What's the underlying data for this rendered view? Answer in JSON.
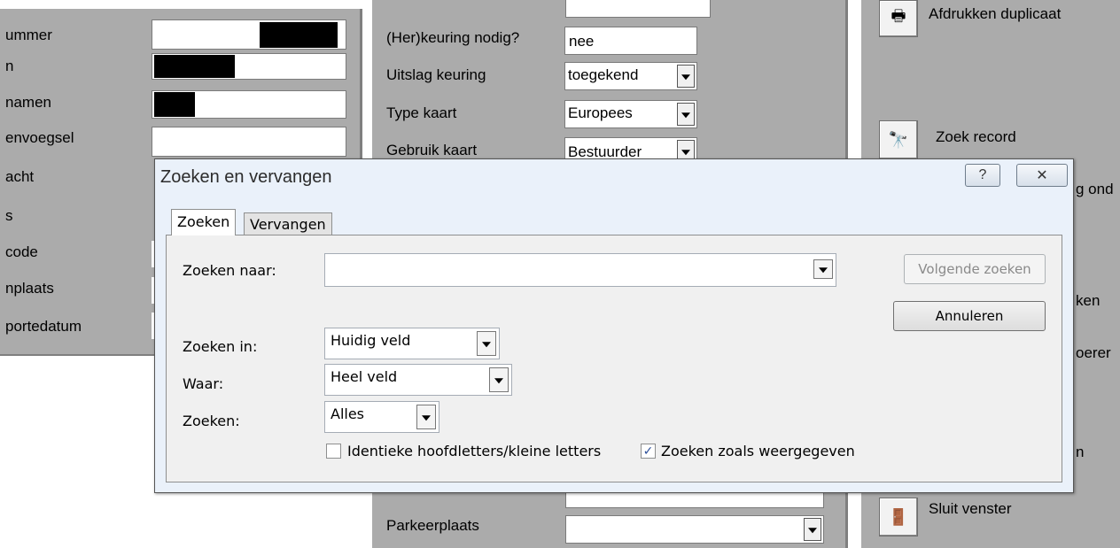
{
  "form_left": {
    "labels": [
      "ummer",
      "n",
      "namen",
      "envoegsel",
      "acht",
      "s",
      "code",
      "nplaats",
      "portedatum"
    ]
  },
  "form_mid": {
    "herkeuring_label": "(Her)keuring nodig?",
    "herkeuring_value": "nee",
    "uitslag_label": "Uitslag keuring",
    "uitslag_value": "toegekend",
    "type_label": "Type kaart",
    "type_value": "Europees",
    "gebruik_label": "Gebruik kaart",
    "gebruik_value": "Bestuurder",
    "parkeer_label": "Parkeerplaats",
    "parkeer_value": ""
  },
  "sidebar": {
    "afdrukken_label": "Afdrukken duplicaat",
    "zoek_label": "Zoek record",
    "partial1": "g ond",
    "partial2": "ken",
    "partial3": "oerer",
    "partial4": "n",
    "sluit_label": "Sluit venster",
    "icons": {
      "print": "🖶",
      "binoculars": "🔭",
      "exit": "🚪"
    }
  },
  "dialog": {
    "title": "Zoeken en vervangen",
    "help_glyph": "?",
    "close_glyph": "✕",
    "tabs": [
      "Zoeken",
      "Vervangen"
    ],
    "zoeken_naar_label": "Zoeken naar:",
    "zoeken_naar_value": "",
    "zoeken_in_label": "Zoeken in:",
    "zoeken_in_value": "Huidig veld",
    "waar_label": "Waar:",
    "waar_value": "Heel veld",
    "zoeken_label": "Zoeken:",
    "zoeken_value": "Alles",
    "volgende_button": "Volgende zoeken",
    "annuleren_button": "Annuleren",
    "match_case_label": "Identieke hoofdletters/kleine letters",
    "match_case_checked": false,
    "as_formatted_label": "Zoeken zoals weergegeven",
    "as_formatted_checked": true,
    "check_glyph": "✓"
  }
}
